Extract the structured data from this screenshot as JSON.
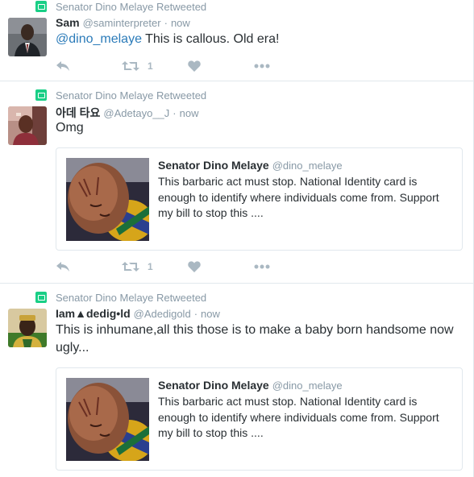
{
  "colors": {
    "accent": "#2b7bb9",
    "retweet": "#19cf86",
    "muted": "#8899a6",
    "border": "#e1e8ed"
  },
  "tweets": [
    {
      "retweeted_by": "Senator Dino Melaye Retweeted",
      "fullname": "Sam",
      "username": "@saminterpreter",
      "separator": "·",
      "time": "now",
      "mention": "@dino_melaye",
      "text": " This is callous. Old era!",
      "retweet_count": "1"
    },
    {
      "retweeted_by": "Senator Dino Melaye Retweeted",
      "fullname": "아데 타요",
      "username": "@Adetayo__J",
      "separator": "·",
      "time": "now",
      "text": "Omg",
      "quote": {
        "name": "Senator Dino Melaye",
        "username": "@dino_melaye",
        "text": "This barbaric act must stop. National Identity card is enough to identify where individuals come from. Support my bill to stop this ...."
      },
      "retweet_count": "1"
    },
    {
      "retweeted_by": "Senator Dino Melaye Retweeted",
      "fullname": "Iam▲dedig•ld",
      "username": "@Adedigold",
      "separator": "·",
      "time": "now",
      "text": "This is inhumane,all this those is to make a baby born handsome now ugly...",
      "quote": {
        "name": "Senator Dino Melaye",
        "username": "@dino_melaye",
        "text": "This barbaric act must stop. National Identity card is enough to identify where individuals come from. Support my bill to stop this ...."
      }
    }
  ]
}
